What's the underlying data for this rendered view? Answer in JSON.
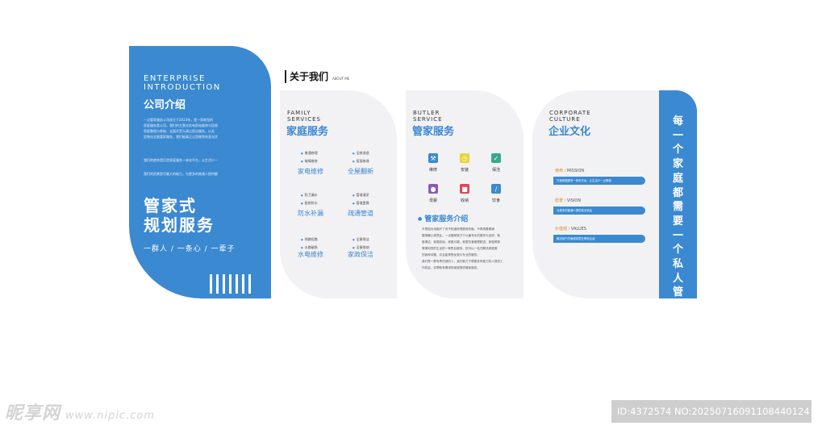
{
  "left_panel": {
    "en_line1": "ENTERPRISE",
    "en_line2": "INTRODUCTION",
    "cn_title": "公司介绍",
    "para1_1": "一点管家服务公司成立于2023年，是一家新型的",
    "para1_2": "家庭服务类公司，我们的主营业务有家电维修与回收",
    "para1_3": "家庭整理与收纳、全屋开荒与清尘保洁服务，以及",
    "para1_4": "定制化全屋管家服务，我们能真正让您做到终身无忧",
    "para2": "我们的使命是打造家庭服务一体化平台，让生活少一",
    "para3": "我们的愿景是尽最大的能力，为更多的普通人提供额",
    "big_line1": "管家式",
    "big_line2": "规划服务",
    "slogan": "一群人 / 一条心 / 一辈子"
  },
  "about": {
    "title": "关于我们",
    "subtitle": "ABOUT ME"
  },
  "family": {
    "en_line1": "FAMILY",
    "en_line2": "SERVICES",
    "cn": "家庭服务",
    "groups": [
      {
        "b1": "普通修理",
        "b2": "故障维修",
        "label": "家电维修"
      },
      {
        "b1": "旧房改造",
        "b2": "瓷面修改",
        "label": "全屋翻新"
      },
      {
        "b1": "防卫漏水",
        "b2": "厨房防水",
        "label": "防水补漏"
      },
      {
        "b1": "管道清淤",
        "b2": "管道更换",
        "label": "疏通管道"
      },
      {
        "b1": "线路短路",
        "b2": "水路破损",
        "label": "水电维修"
      },
      {
        "b1": "全屋保洁",
        "b2": "全屋收纳",
        "label": "家政保洁"
      }
    ]
  },
  "butler": {
    "en_line1": "BUTLER",
    "en_line2": "SERVICE",
    "cn": "管家服务",
    "icons": [
      {
        "icon": "wrench-icon",
        "label": "维修",
        "color": "#3b89d0"
      },
      {
        "icon": "clock-icon",
        "label": "安装",
        "color": "#e9d43a"
      },
      {
        "icon": "broom-icon",
        "label": "保洁",
        "color": "#3aa88e"
      },
      {
        "icon": "bottle-icon",
        "label": "母婴",
        "color": "#8b5bb0"
      },
      {
        "icon": "box-icon",
        "label": "收纳",
        "color": "#e0484f"
      },
      {
        "icon": "knife-icon",
        "label": "饮食",
        "color": "#3b89d0"
      }
    ],
    "sub_title": "管家服务介绍",
    "text1": "不再因为电脑开了但不知道修理费而伤脑、不再再看着满",
    "text2": "屋狼藉心烦意乱。一点管家致力于以最专业的服务与品质、家",
    "text3": "庭清洁、家庭收纳、家庭月嫂、家庭饮食管理配送、家庭教育",
    "text4": "等便利您的生活的一种售后服务。您可以一站式解决家庭服",
    "text5": "的各种问题，并且能享受优惠与专业的服务。",
    "text6": "我们是一群有责任感的人，我们致力于帮更多有能力的人提供工",
    "text7": "作机会，并帮助有需求的家庭提供管家服务。"
  },
  "culture": {
    "en_line1": "CORPORATE",
    "en_line2": "CULTURE",
    "cn": "企业文化",
    "items": [
      {
        "cn": "使命",
        "en": "MISSION",
        "text": "打造家庭服务一体化平台，让生活少一点麻烦"
      },
      {
        "cn": "愿景",
        "en": "VISION",
        "text": "为更多的普通人提供就业机会"
      },
      {
        "cn": "价值观",
        "en": "VALUES",
        "text": "解决用户的麻烦将意在帮助合适"
      }
    ]
  },
  "right_panel": {
    "vertical": "每一个家庭都需要一个私人管家"
  },
  "watermark": {
    "brand": "昵享网",
    "url": "www.nipic.com",
    "id": "ID:4372574 NO:20250716091108440124"
  }
}
